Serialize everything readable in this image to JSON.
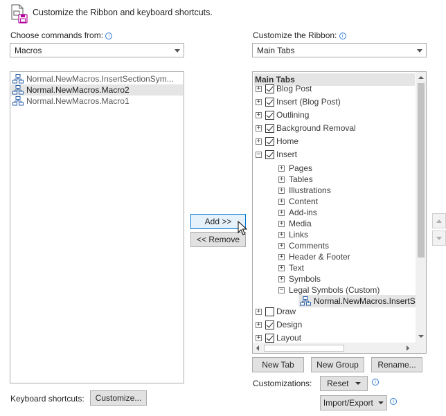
{
  "header": {
    "title": "Customize the Ribbon and keyboard shortcuts."
  },
  "left": {
    "label": "Choose commands from:",
    "dropdown_value": "Macros",
    "items": [
      {
        "label": "Normal.NewMacros.InsertSectionSym..."
      },
      {
        "label": "Normal.NewMacros.Macro2"
      },
      {
        "label": "Normal.NewMacros.Macro1"
      }
    ]
  },
  "right": {
    "label": "Customize the Ribbon:",
    "dropdown_value": "Main Tabs",
    "tree_header": "Main Tabs",
    "tabs": {
      "blog_post": "Blog Post",
      "insert_blog": "Insert (Blog Post)",
      "outlining": "Outlining",
      "bg_removal": "Background Removal",
      "home": "Home",
      "insert": "Insert",
      "pages": "Pages",
      "tables": "Tables",
      "illustrations": "Illustrations",
      "content": "Content",
      "addins": "Add-ins",
      "media": "Media",
      "links": "Links",
      "comments": "Comments",
      "header_footer": "Header & Footer",
      "text": "Text",
      "symbols": "Symbols",
      "legal_symbols": "Legal Symbols (Custom)",
      "custom_cmd": "Normal.NewMacros.InsertS",
      "draw": "Draw",
      "design": "Design",
      "layout": "Layout"
    }
  },
  "buttons": {
    "add": "Add >>",
    "remove": "<< Remove",
    "new_tab": "New Tab",
    "new_group": "New Group",
    "rename": "Rename...",
    "reset": "Reset",
    "import_export": "Import/Export",
    "customize": "Customize..."
  },
  "labels": {
    "customizations": "Customizations:",
    "keyboard_shortcuts": "Keyboard shortcuts:"
  },
  "icons": [
    "customize-ribbon-icon",
    "info-icon",
    "macro-icon",
    "chevron-down-icon",
    "mouse-cursor-icon",
    "move-up-icon",
    "move-down-icon"
  ]
}
